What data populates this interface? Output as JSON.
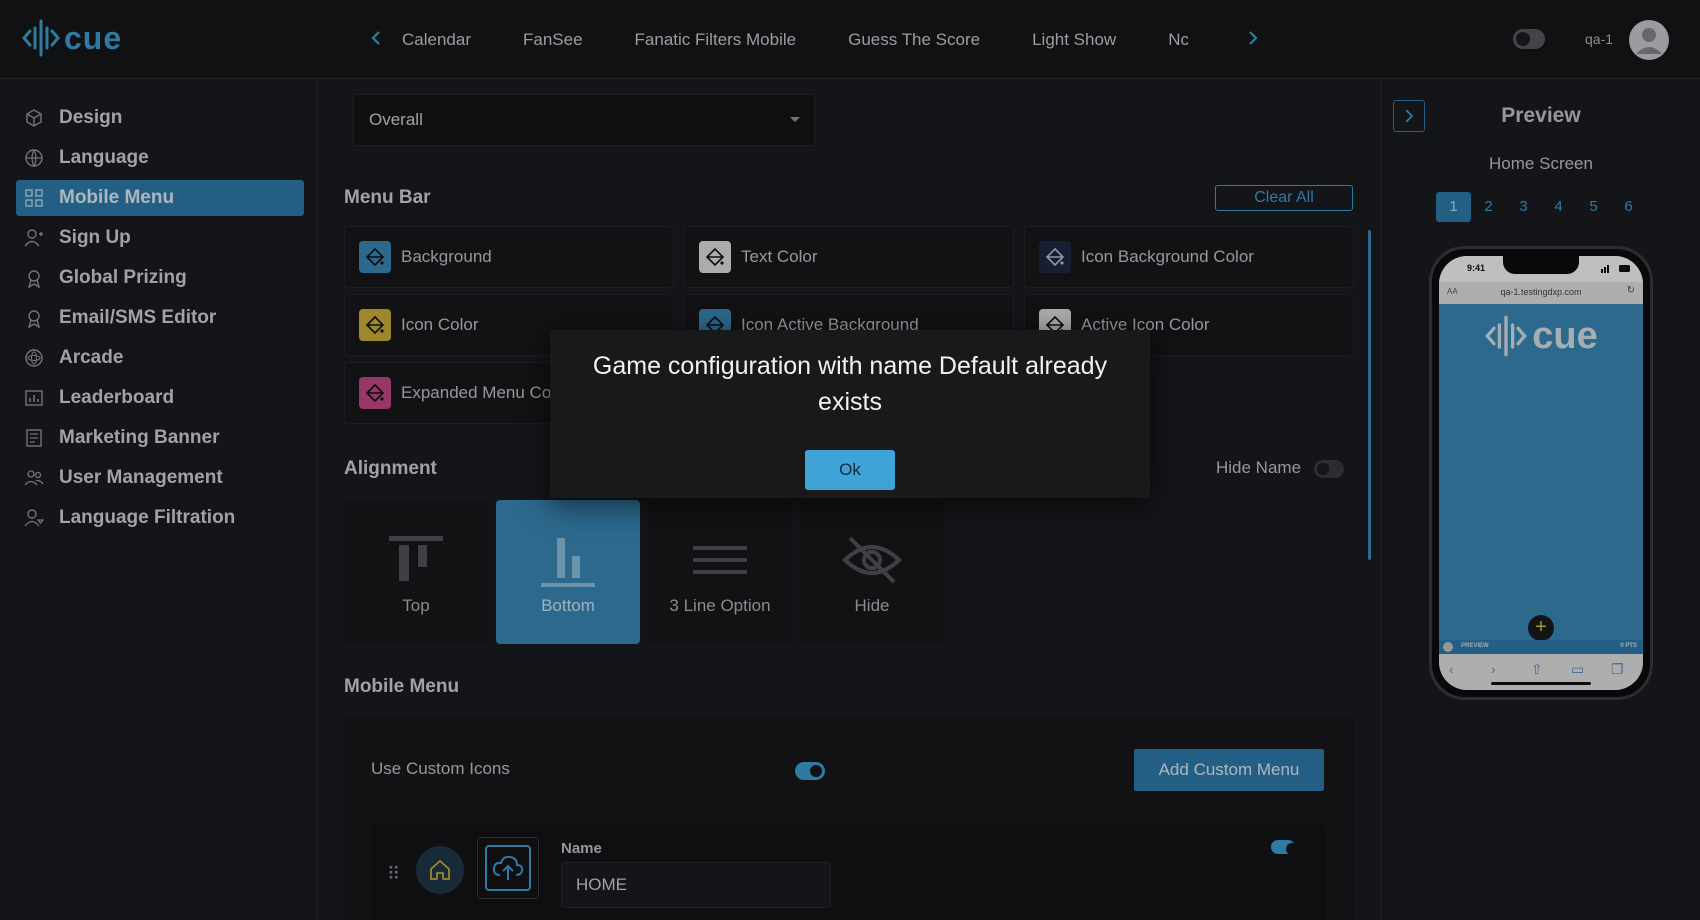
{
  "app": {
    "logo_text": "cue",
    "brand_color": "#3fa3d8"
  },
  "nav": {
    "tabs": [
      "Calendar",
      "FanSee",
      "Fanatic Filters Mobile",
      "Guess The Score",
      "Light Show",
      "Nc"
    ],
    "prev_icon": "chevron-left-icon",
    "next_icon": "chevron-right-icon"
  },
  "user": {
    "name": "qa-1",
    "theme_toggle_icon": "theme-toggle-icon"
  },
  "sidebar": {
    "items": [
      {
        "label": "Design",
        "icon": "cube-icon"
      },
      {
        "label": "Language",
        "icon": "globe-icon"
      },
      {
        "label": "Mobile Menu",
        "icon": "grid-icon",
        "active": true
      },
      {
        "label": "Sign Up",
        "icon": "user-plus-icon"
      },
      {
        "label": "Global Prizing",
        "icon": "award-icon"
      },
      {
        "label": "Email/SMS Editor",
        "icon": "award-icon"
      },
      {
        "label": "Arcade",
        "icon": "atom-icon"
      },
      {
        "label": "Leaderboard",
        "icon": "chart-icon"
      },
      {
        "label": "Marketing Banner",
        "icon": "newspaper-icon"
      },
      {
        "label": "User Management",
        "icon": "users-icon"
      },
      {
        "label": "Language Filtration",
        "icon": "user-filter-icon"
      }
    ]
  },
  "main": {
    "select_value": "Overall",
    "menu_bar": {
      "title": "Menu Bar",
      "clear_all": "Clear All",
      "cards": [
        {
          "label": "Background",
          "color": "#3b8dbd"
        },
        {
          "label": "Text Color",
          "color": "#e6e6e6"
        },
        {
          "label": "Icon Background Color",
          "color": "#1e2a40"
        },
        {
          "label": "Icon Color",
          "color": "#d4b43a"
        },
        {
          "label": "Icon Active Background",
          "color": "#3b8dbd"
        },
        {
          "label": "Active Icon Color",
          "color": "#e6e6e6"
        },
        {
          "label": "Expanded Menu Color",
          "color": "#c84a8a"
        }
      ]
    },
    "alignment": {
      "title": "Alignment",
      "hide_name_label": "Hide Name",
      "options": [
        {
          "label": "Top",
          "icon": "align-top-icon"
        },
        {
          "label": "Bottom",
          "icon": "align-bottom-icon",
          "active": true
        },
        {
          "label": "3 Line Option",
          "icon": "three-line-icon"
        },
        {
          "label": "Hide",
          "icon": "eye-off-icon"
        }
      ]
    },
    "mobile_menu": {
      "title": "Mobile Menu",
      "use_custom_icons": "Use Custom Icons",
      "add_custom_menu": "Add Custom Menu",
      "item": {
        "name_label": "Name",
        "name_value": "HOME",
        "icon": "home-icon"
      }
    }
  },
  "preview": {
    "title": "Preview",
    "screen": "Home Screen",
    "pages": [
      "1",
      "2",
      "3",
      "4",
      "5",
      "6"
    ],
    "active_page": "1",
    "phone": {
      "time": "9:41",
      "url_aa": "AA",
      "url": "qa-1.testingdxp.com",
      "logo_text": "cue",
      "strip_left": "PREVIEW",
      "strip_right": "0 PTS",
      "bg_color": "#3b8dbd"
    }
  },
  "modal": {
    "message": "Game configuration with name Default already exists",
    "ok": "Ok"
  }
}
